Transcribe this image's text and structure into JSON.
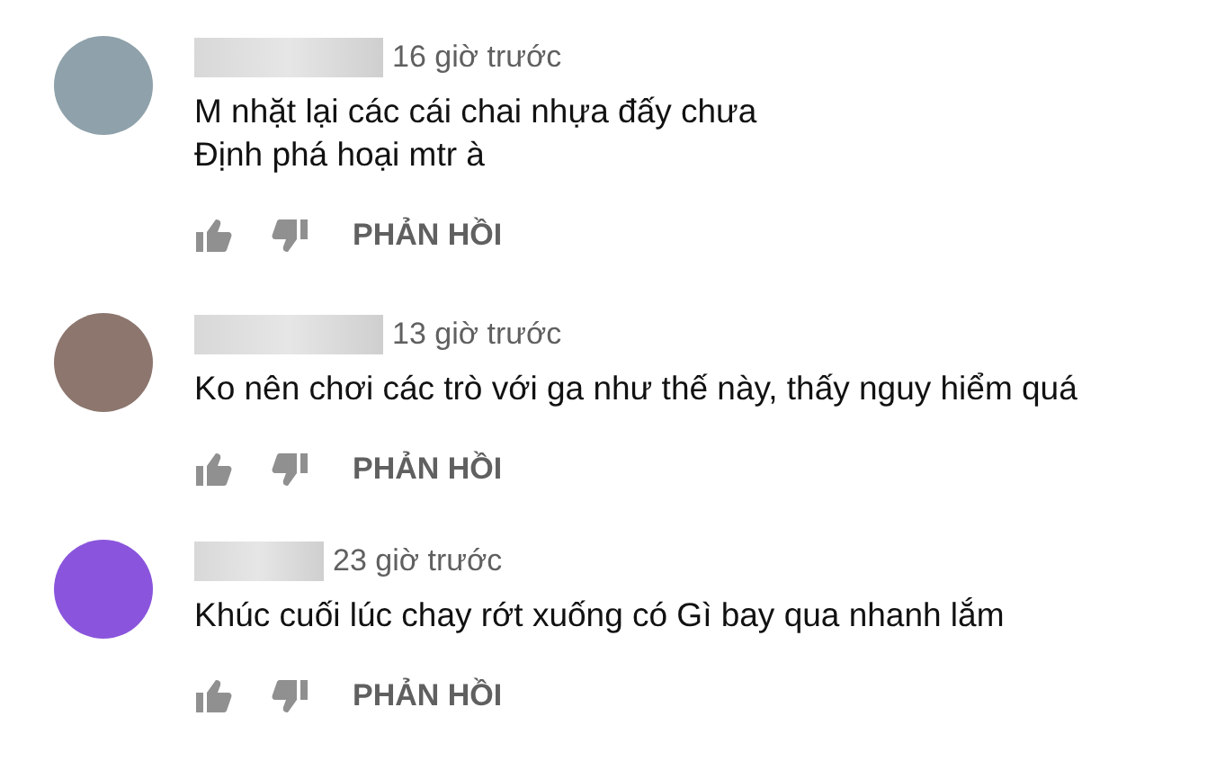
{
  "comments": [
    {
      "color": "#8fa1aa",
      "time": "16 giờ trước",
      "lines": [
        "M nhặt lại các cái chai nhựa đấy chưa",
        "Định phá hoại mtr à"
      ],
      "reply": "PHẢN HỒI"
    },
    {
      "color": "#8c766e",
      "time": "13 giờ trước",
      "lines": [
        "Ko nên chơi các trò với ga như thế này, thấy nguy hiểm quá"
      ],
      "reply": "PHẢN HỒI"
    },
    {
      "color": "#8a55dc",
      "time": "23 giờ trước",
      "lines": [
        "Khúc cuối lúc chay rớt xuống có Gì bay qua nhanh lắm"
      ],
      "reply": "PHẢN HỒI"
    }
  ]
}
